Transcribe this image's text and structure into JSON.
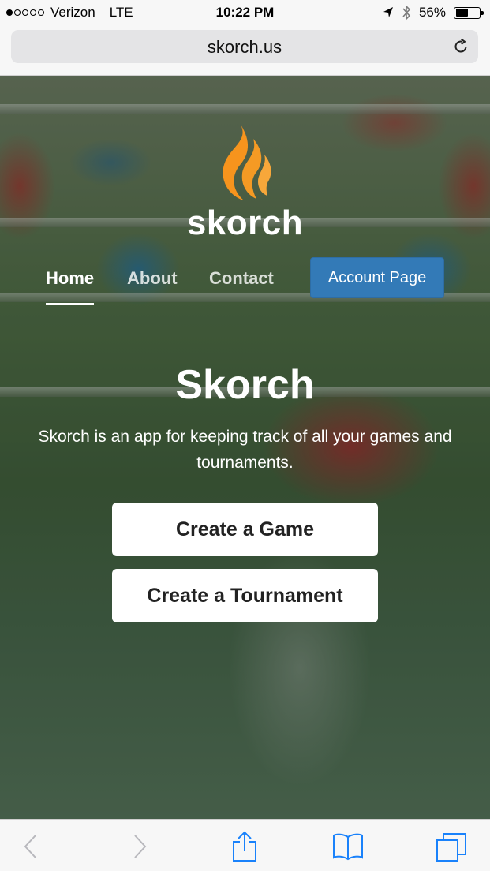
{
  "status_bar": {
    "signal_bars_total": 5,
    "signal_bars_filled": 1,
    "carrier": "Verizon",
    "network": "LTE",
    "time": "10:22 PM",
    "battery_percent_label": "56%",
    "battery_level": 0.56,
    "icons": [
      "location-arrow-icon",
      "bluetooth-icon",
      "battery-icon"
    ]
  },
  "browser": {
    "url": "skorch.us",
    "reload_icon": "reload-icon"
  },
  "site": {
    "logo_text": "skorch",
    "brand_color": "#f7941d",
    "nav": {
      "items": [
        {
          "label": "Home",
          "active": true
        },
        {
          "label": "About",
          "active": false
        },
        {
          "label": "Contact",
          "active": false
        }
      ],
      "account_button": "Account Page",
      "account_button_color": "#337ab7"
    },
    "headline": "Skorch",
    "tagline": "Skorch is an app for keeping track of all your games and tournaments.",
    "buttons": {
      "create_game": "Create a Game",
      "create_tournament": "Create a Tournament"
    }
  },
  "toolbar": {
    "icons": [
      "back-icon",
      "forward-icon",
      "share-icon",
      "bookmarks-icon",
      "tabs-icon"
    ],
    "accent_color": "#1a82fb",
    "disabled_color": "#b8b8bd"
  }
}
